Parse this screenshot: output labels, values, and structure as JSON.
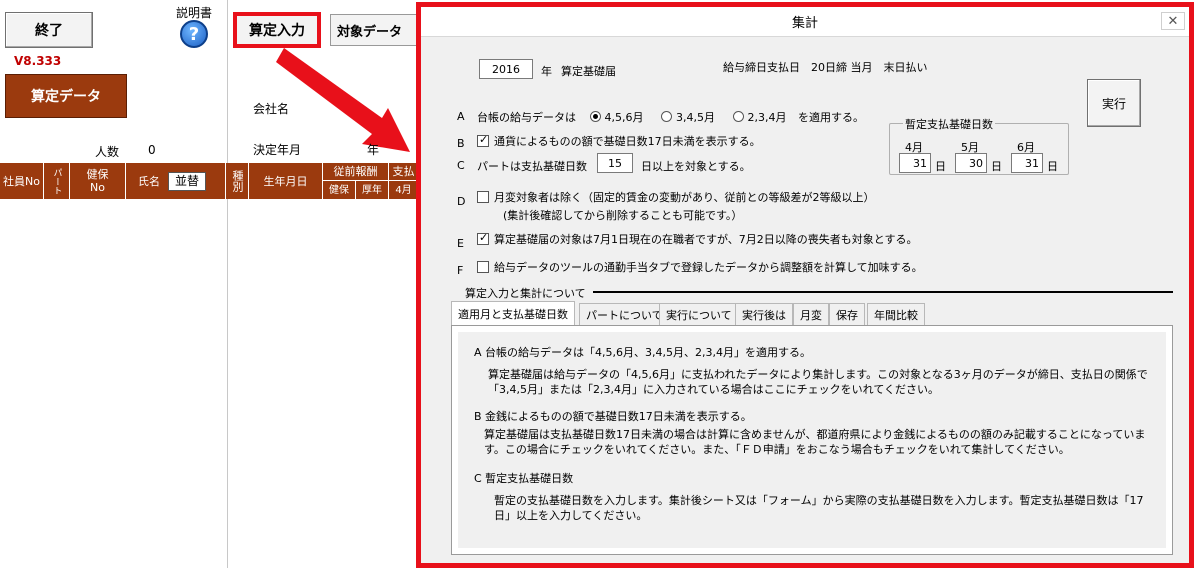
{
  "app": {
    "exit_label": "終了",
    "manual_label": "説明書",
    "version": "V8.333",
    "santei_data_label": "算定データ",
    "tab_input_label": "算定入力",
    "tab_target_label": "対象データ",
    "company_label": "会社名",
    "headcount_label": "人数",
    "headcount_value": "0",
    "decision_ym_label": "決定年月",
    "year_suffix": "年",
    "columns": {
      "emp_no": "社員No",
      "part": "パート",
      "ins_no_line1": "健保",
      "ins_no_line2": "No",
      "name": "氏名",
      "sort_button": "並替",
      "kind": "種別",
      "birth": "生年月日",
      "prev_pay": "従前報酬",
      "kenpo": "健保",
      "kosei": "厚年",
      "shiharai": "支払",
      "april": "4月"
    }
  },
  "dialog": {
    "title": "集計",
    "year_value": "2016",
    "year_unit": "年",
    "doc_label": "算定基礎届",
    "payday_info": "給与締日支払日　20日締 当月　末日払い",
    "execute_label": "実行",
    "A": {
      "letter": "A",
      "lead": "台帳の給与データは",
      "opt1": "4,5,6月",
      "opt2": "3,4,5月",
      "opt3": "2,3,4月",
      "trail": "を適用する。"
    },
    "B": {
      "letter": "B",
      "text": "通貨によるものの額で基礎日数17日未満を表示する。"
    },
    "C": {
      "letter": "C",
      "lead": "パートは支払基礎日数",
      "days": "15",
      "trail": "日以上を対象とする。"
    },
    "D": {
      "letter": "D",
      "text": "月変対象者は除く（固定的賃金の変動があり、従前との等級差が2等級以上）",
      "sub": "(集計後確認してから削除することも可能です。）"
    },
    "E": {
      "letter": "E",
      "text": "算定基礎届の対象は7月1日現在の在職者ですが、7月2日以降の喪失者も対象とする。"
    },
    "F": {
      "letter": "F",
      "text": "給与データのツールの通勤手当タブで登録したデータから調整額を計算して加味する。"
    },
    "provisional": {
      "title": "暫定支払基礎日数",
      "months": [
        "4月",
        "5月",
        "6月"
      ],
      "values": [
        "31",
        "30",
        "31"
      ],
      "unit": "日"
    },
    "about_heading": "算定入力と集計について",
    "tabs": [
      "適用月と支払基礎日数",
      "パートについて",
      "実行について",
      "実行後は",
      "月変",
      "保存",
      "年間比較"
    ],
    "panel": {
      "a_head": "A  台帳の給与データは「4,5,6月、3,4,5月、2,3,4月」を適用する。",
      "a_l1": "算定基礎届は給与データの「4,5,6月」に支払われたデータにより集計します。この対象となる3ヶ月のデータが締日、支払日の関係で",
      "a_l2": "「3,4,5月」または「2,3,4月」に入力されている場合はここにチェックをいれてください。",
      "b_head": "B  金銭によるものの額で基礎日数17日未満を表示する。",
      "b_l1": "算定基礎届は支払基礎日数17日未満の場合は計算に含めませんが、都道府県により金銭によるものの額のみ記載することになっていま",
      "b_l2": "す。この場合にチェックをいれてください。また、「ＦＤ申請」をおこなう場合もチェックをいれて集計してください。",
      "c_head": "C  暫定支払基礎日数",
      "c_l1": "暫定の支払基礎日数を入力します。集計後シート又は「フォーム」から実際の支払基礎日数を入力します。暫定支払基礎日数は「17",
      "c_l2": "日」以上を入力してください。"
    }
  }
}
